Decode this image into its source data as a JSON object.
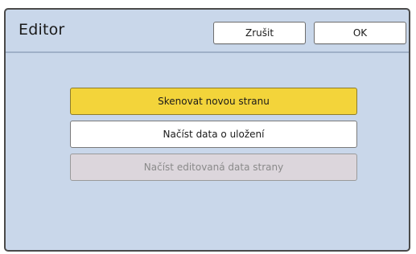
{
  "header": {
    "title": "Editor",
    "cancel_label": "Zrušit",
    "ok_label": "OK"
  },
  "options": [
    {
      "label": "Skenovat novou stranu",
      "state": "selected"
    },
    {
      "label": "Načíst data o uložení",
      "state": "enabled"
    },
    {
      "label": "Načíst editovaná data strany",
      "state": "disabled"
    }
  ],
  "colors": {
    "panel_bg": "#c9d7ea",
    "selected_bg": "#f3d43a",
    "disabled_bg": "#dcd6dc"
  }
}
